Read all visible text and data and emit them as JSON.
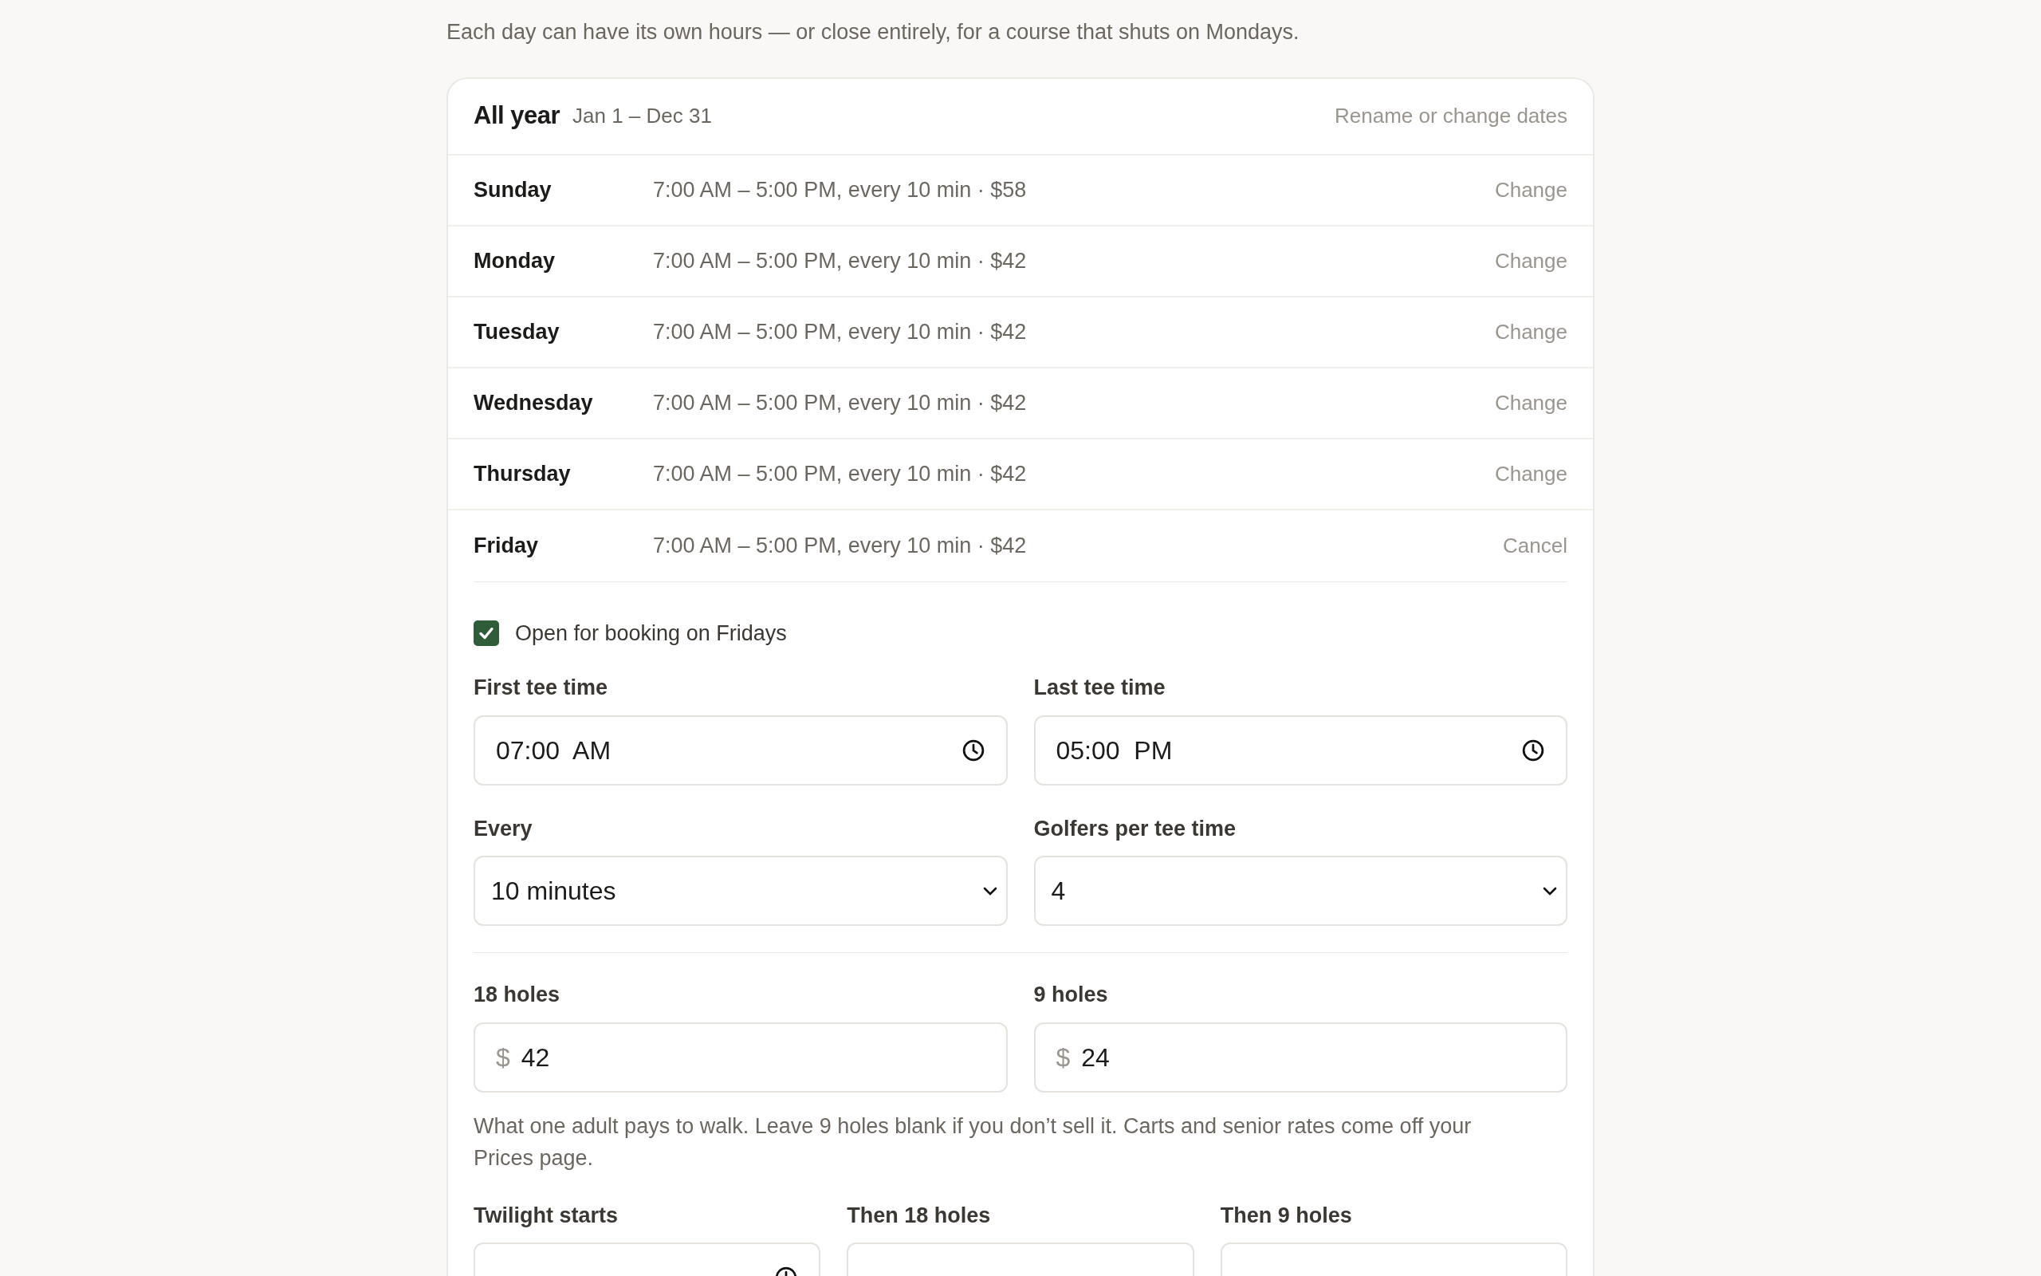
{
  "intro": "Each day can have its own hours — or close entirely, for a course that shuts on Mondays.",
  "period": {
    "name": "All year",
    "dates": "Jan 1 – Dec 31",
    "action": "Rename or change dates"
  },
  "days": [
    {
      "day": "Sunday",
      "summary": "7:00 AM – 5:00 PM, every 10 min · $58",
      "action": "Change",
      "expanded": false
    },
    {
      "day": "Monday",
      "summary": "7:00 AM – 5:00 PM, every 10 min · $42",
      "action": "Change",
      "expanded": false
    },
    {
      "day": "Tuesday",
      "summary": "7:00 AM – 5:00 PM, every 10 min · $42",
      "action": "Change",
      "expanded": false
    },
    {
      "day": "Wednesday",
      "summary": "7:00 AM – 5:00 PM, every 10 min · $42",
      "action": "Change",
      "expanded": false
    },
    {
      "day": "Thursday",
      "summary": "7:00 AM – 5:00 PM, every 10 min · $42",
      "action": "Change",
      "expanded": false
    },
    {
      "day": "Friday",
      "summary": "7:00 AM – 5:00 PM, every 10 min · $42",
      "action": "Cancel",
      "expanded": true
    }
  ],
  "editor": {
    "open_checkbox": {
      "label": "Open for booking on Fridays",
      "checked": true
    },
    "schedule_rows": [
      [
        {
          "kind": "time",
          "label": "First tee time",
          "value": "07:00  AM"
        },
        {
          "kind": "time",
          "label": "Last tee time",
          "value": "05:00  PM"
        }
      ],
      [
        {
          "kind": "select",
          "label": "Every",
          "value": "10 minutes"
        },
        {
          "kind": "select",
          "label": "Golfers per tee time",
          "value": "4"
        }
      ]
    ],
    "price_rows": [
      [
        {
          "kind": "money",
          "label": "18 holes",
          "prefix": "$",
          "value": "42"
        },
        {
          "kind": "money",
          "label": "9 holes",
          "prefix": "$",
          "value": "24"
        }
      ]
    ],
    "price_help": "What one adult pays to walk. Leave 9 holes blank if you don’t sell it. Carts and senior rates come off your Prices page.",
    "twilight_row": [
      {
        "kind": "time",
        "label": "Twilight starts"
      },
      {
        "kind": "money",
        "label": "Then 18 holes"
      },
      {
        "kind": "money",
        "label": "Then 9 holes"
      }
    ]
  }
}
